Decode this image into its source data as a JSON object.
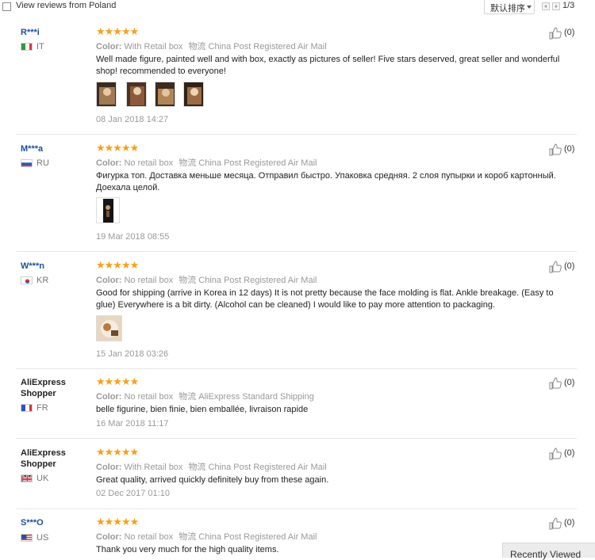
{
  "filter": {
    "view_poland_label": "View reviews from Poland"
  },
  "sort": {
    "label": "默认排序"
  },
  "pagination": {
    "count_text": "1/3"
  },
  "reviews": [
    {
      "name": "R***i",
      "country": "IT",
      "stars": "★★★★★",
      "color_label": "Color:",
      "color_value": "With Retail box",
      "ship_label": "物流",
      "ship_value": "China Post Registered Air Mail",
      "text": "Well made figure, painted well and with box, exactly as pictures of seller! Five stars deserved, great seller and wonderful shop! recommended to everyone!",
      "date": "08 Jan 2018 14:27",
      "helpful": "(0)"
    },
    {
      "name": "M***a",
      "country": "RU",
      "stars": "★★★★★",
      "color_label": "Color:",
      "color_value": "No retail box",
      "ship_label": "物流",
      "ship_value": "China Post Registered Air Mail",
      "text": "Фигурка топ. Доставка меньше месяца. Отправил быстро. Упаковка средняя. 2 слоя пупырки и короб картонный. Доехала целой.",
      "date": "19 Mar 2018 08:55",
      "helpful": "(0)"
    },
    {
      "name": "W***n",
      "country": "KR",
      "stars": "★★★★★",
      "color_label": "Color:",
      "color_value": "No retail box",
      "ship_label": "物流",
      "ship_value": "China Post Registered Air Mail",
      "text": "Good for shipping (arrive in Korea in 12 days) It is not pretty because the face molding is flat. Ankle breakage. (Easy to glue) Everywhere is a bit dirty. (Alcohol can be cleaned) I would like to pay more attention to packaging.",
      "date": "15 Jan 2018 03:26",
      "helpful": "(0)"
    },
    {
      "name": "AliExpress Shopper",
      "country": "FR",
      "stars": "★★★★★",
      "color_label": "Color:",
      "color_value": "No retail box",
      "ship_label": "物流",
      "ship_value": "AliExpress Standard Shipping",
      "text": "belle figurine, bien finie, bien emballée, livraison rapide",
      "date": "16 Mar 2018 11:17",
      "helpful": "(0)"
    },
    {
      "name": "AliExpress Shopper",
      "country": "UK",
      "stars": "★★★★★",
      "color_label": "Color:",
      "color_value": "With Retail box",
      "ship_label": "物流",
      "ship_value": "China Post Registered Air Mail",
      "text": "Great quality, arrived quickly definitely buy from these again.",
      "date": "02 Dec 2017 01:10",
      "helpful": "(0)"
    },
    {
      "name": "S***O",
      "country": "US",
      "stars": "★★★★★",
      "color_label": "Color:",
      "color_value": "No retail box",
      "ship_label": "物流",
      "ship_value": "China Post Registered Air Mail",
      "text": "Thank you very much for the high quality items.",
      "helpful": "(0)"
    }
  ],
  "recently_viewed": {
    "label": "Recently Viewed"
  },
  "icons": {
    "checkbox": "checkbox-icon",
    "caret": "chevron-down-icon",
    "prev": "chevron-left-icon",
    "next": "chevron-right-icon",
    "thumb": "thumbs-up-icon",
    "stars": "star-icon",
    "flag": "flag-icon"
  },
  "colors": {
    "name_link": "#1c4f9a",
    "star": "#f7a01a",
    "meta": "#999999",
    "separator": "#e6e6e6"
  }
}
